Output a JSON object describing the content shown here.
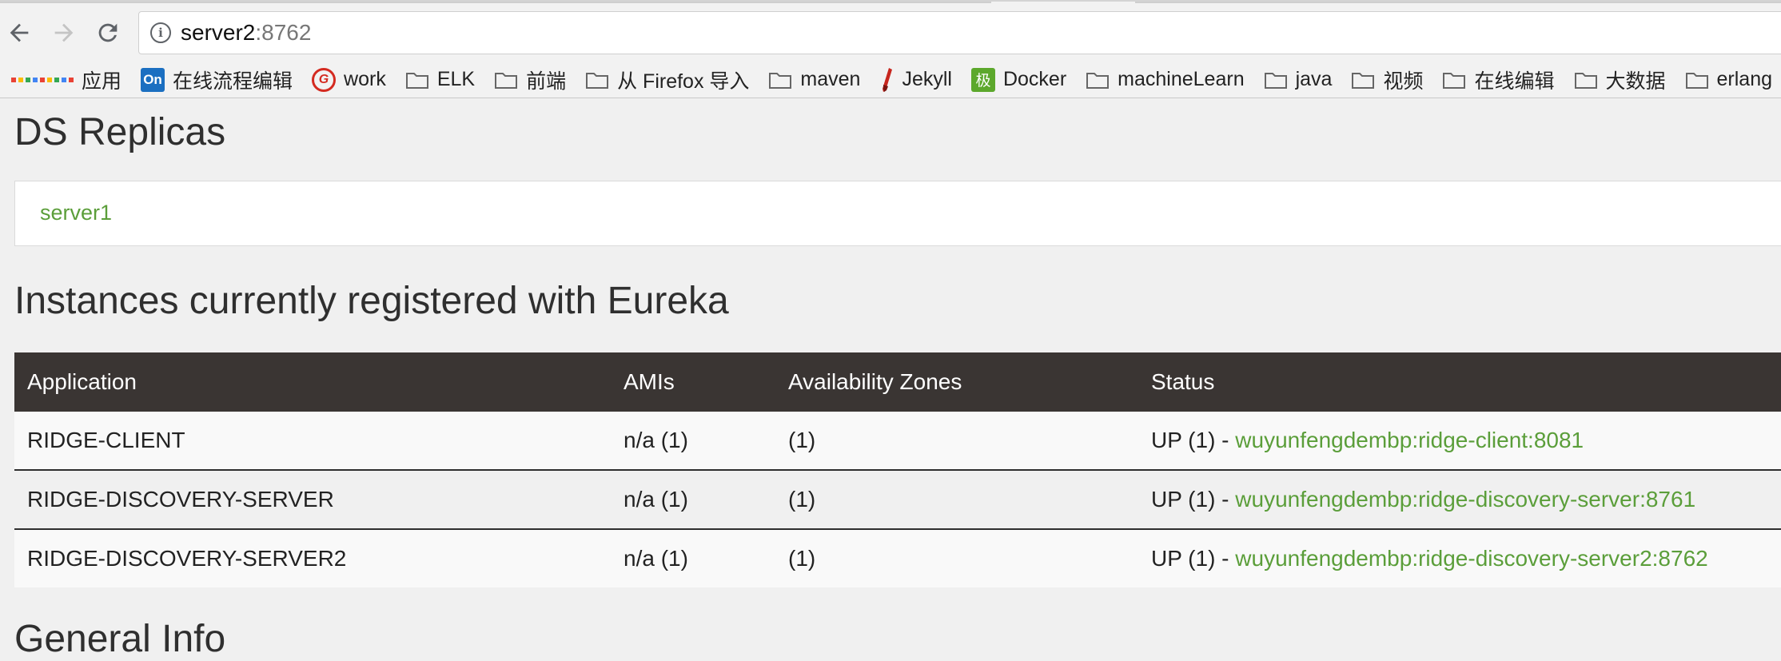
{
  "browser": {
    "url_host": "server2",
    "url_port": ":8762"
  },
  "bookmarks": [
    {
      "label": "应用",
      "icon": "apps-grid-icon"
    },
    {
      "label": "在线流程编辑",
      "icon": "processon-icon"
    },
    {
      "label": "work",
      "icon": "work-icon"
    },
    {
      "label": "ELK",
      "icon": "folder-icon"
    },
    {
      "label": "前端",
      "icon": "folder-icon"
    },
    {
      "label": "从 Firefox 导入",
      "icon": "folder-icon"
    },
    {
      "label": "maven",
      "icon": "folder-icon"
    },
    {
      "label": "Jekyll",
      "icon": "jekyll-icon"
    },
    {
      "label": "Docker",
      "icon": "jike-icon"
    },
    {
      "label": "machineLearn",
      "icon": "folder-icon"
    },
    {
      "label": "java",
      "icon": "folder-icon"
    },
    {
      "label": "视频",
      "icon": "folder-icon"
    },
    {
      "label": "在线编辑",
      "icon": "folder-icon"
    },
    {
      "label": "大数据",
      "icon": "folder-icon"
    },
    {
      "label": "erlang",
      "icon": "folder-icon"
    }
  ],
  "page": {
    "replicas_heading": "DS Replicas",
    "replicas": [
      "server1"
    ],
    "instances_heading": "Instances currently registered with Eureka",
    "general_heading": "General Info",
    "table": {
      "headers": [
        "Application",
        "AMIs",
        "Availability Zones",
        "Status"
      ],
      "rows": [
        {
          "application": "RIDGE-CLIENT",
          "amis": "n/a (1)",
          "zones": "(1)",
          "status_prefix": "UP (1) - ",
          "status_link": "wuyunfengdembp:ridge-client:8081"
        },
        {
          "application": "RIDGE-DISCOVERY-SERVER",
          "amis": "n/a (1)",
          "zones": "(1)",
          "status_prefix": "UP (1) - ",
          "status_link": "wuyunfengdembp:ridge-discovery-server:8761"
        },
        {
          "application": "RIDGE-DISCOVERY-SERVER2",
          "amis": "n/a (1)",
          "zones": "(1)",
          "status_prefix": "UP (1) - ",
          "status_link": "wuyunfengdembp:ridge-discovery-server2:8762"
        }
      ]
    }
  },
  "colors": {
    "link": "#5b9e3a",
    "table_header_bg": "#3a3533",
    "page_bg": "#f0f0f0"
  }
}
